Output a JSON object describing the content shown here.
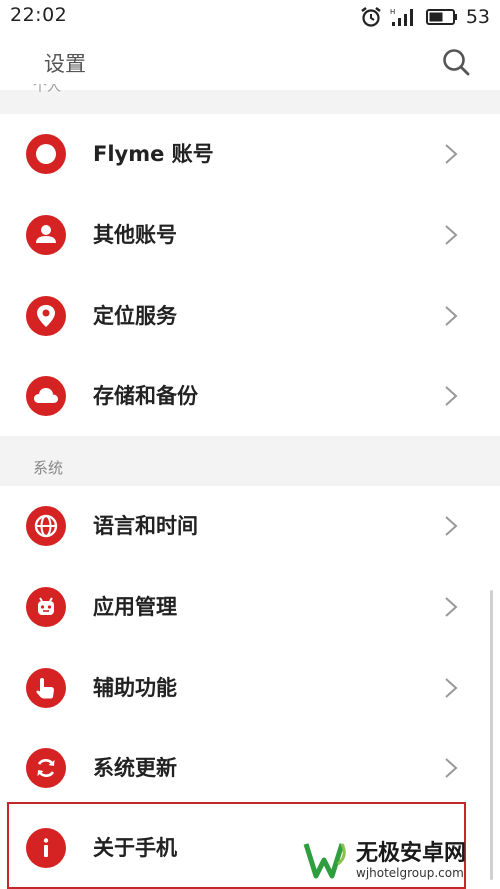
{
  "status_bar": {
    "time": "22:02",
    "battery": "53",
    "icons": [
      "alarm-icon",
      "signal-icon",
      "battery-icon"
    ]
  },
  "header": {
    "title": "设置",
    "search_icon": "search-icon"
  },
  "sections": {
    "personal_peek": "个人",
    "system_title": "系统"
  },
  "personal_items": [
    {
      "label": "Flyme 账号",
      "icon": "flyme-icon"
    },
    {
      "label": "其他账号",
      "icon": "person-icon"
    },
    {
      "label": "定位服务",
      "icon": "location-pin-icon"
    },
    {
      "label": "存储和备份",
      "icon": "cloud-icon"
    }
  ],
  "system_items": [
    {
      "label": "语言和时间",
      "icon": "globe-icon"
    },
    {
      "label": "应用管理",
      "icon": "robot-icon"
    },
    {
      "label": "辅助功能",
      "icon": "hand-pointer-icon"
    },
    {
      "label": "系统更新",
      "icon": "refresh-icon"
    },
    {
      "label": "关于手机",
      "icon": "info-icon"
    }
  ],
  "watermark": {
    "title": "无极安卓网",
    "url": "wjhotelgroup.com"
  },
  "colors": {
    "accent": "#d42322",
    "highlight": "#c4272a",
    "background": "#f3f3f3"
  }
}
